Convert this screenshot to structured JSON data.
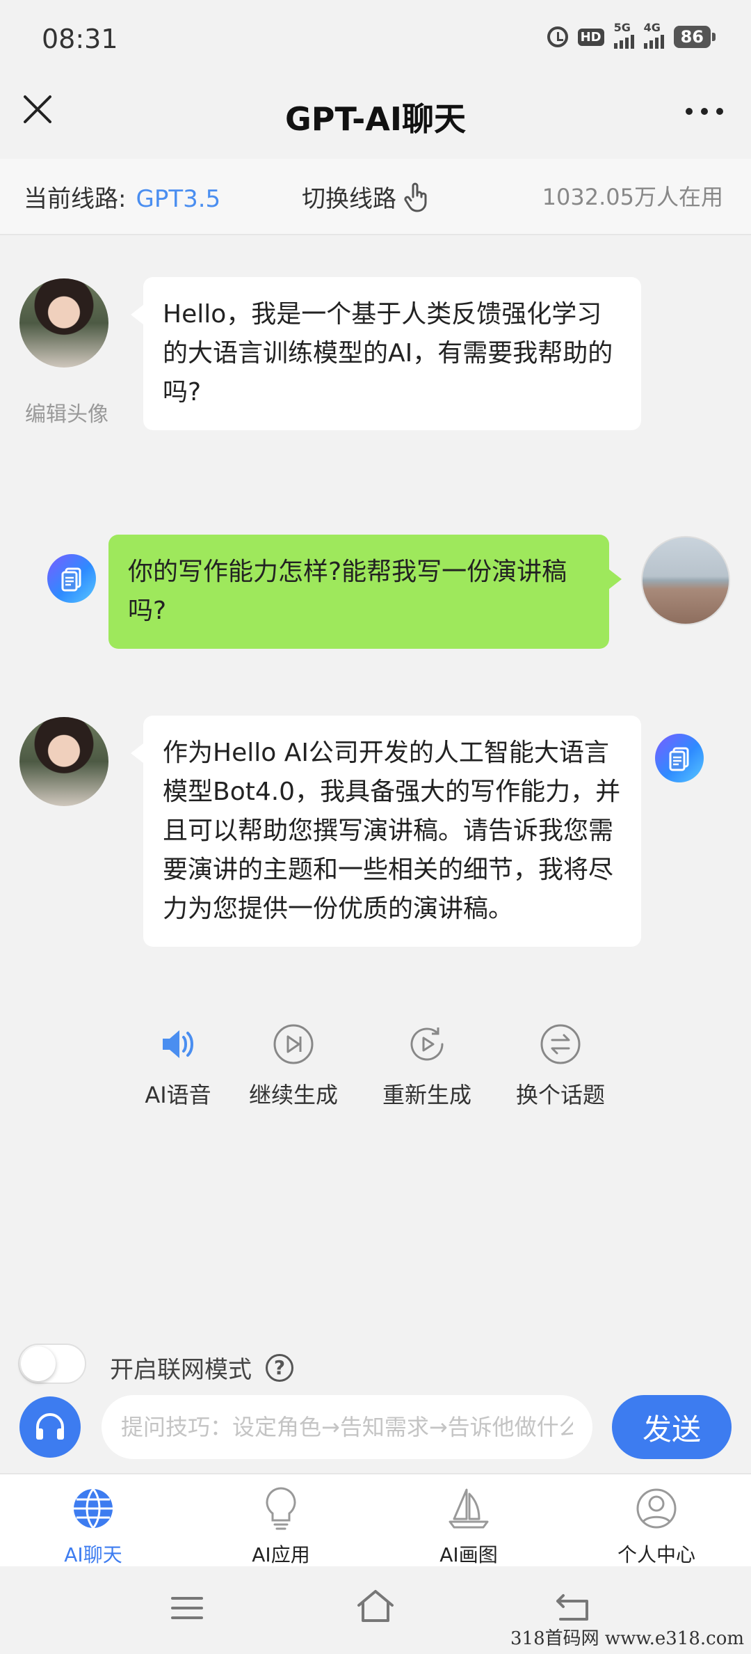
{
  "status_bar": {
    "time": "08:31",
    "hd_label": "HD",
    "net1": "5G",
    "net2": "4G",
    "battery": "86"
  },
  "navbar": {
    "title": "GPT-AI聊天",
    "close_icon": "close-icon",
    "more_icon": "more-icon"
  },
  "line_bar": {
    "current_label": "当前线路:",
    "current_value": "GPT3.5",
    "switch_label": "切换线路",
    "users": "1032.05万人在用"
  },
  "chat": {
    "edit_avatar": "编辑头像",
    "messages": [
      {
        "from": "ai",
        "text": "Hello，我是一个基于人类反馈强化学习的大语言训练模型的AI，有需要我帮助的吗?"
      },
      {
        "from": "user",
        "text": "你的写作能力怎样?能帮我写一份演讲稿吗?"
      },
      {
        "from": "ai",
        "text": "作为Hello AI公司开发的人工智能大语言模型Bot4.0，我具备强大的写作能力，并且可以帮助您撰写演讲稿。请告诉我您需要演讲的主题和一些相关的细节，我将尽力为您提供一份优质的演讲稿。"
      }
    ],
    "actions": [
      {
        "label": "AI语音",
        "icon": "speaker-icon"
      },
      {
        "label": "继续生成",
        "icon": "skip-forward-icon"
      },
      {
        "label": "重新生成",
        "icon": "replay-icon"
      },
      {
        "label": "换个话题",
        "icon": "switch-icon"
      }
    ]
  },
  "composer": {
    "web_mode_label": "开启联网模式",
    "web_mode_on": false,
    "placeholder": "提问技巧：设定角色→告知需求→告诉他做什么",
    "send_label": "发送"
  },
  "tabs": [
    {
      "label": "AI聊天",
      "icon": "globe-icon",
      "active": true
    },
    {
      "label": "AI应用",
      "icon": "lightbulb-icon",
      "active": false
    },
    {
      "label": "AI画图",
      "icon": "sailboat-icon",
      "active": false
    },
    {
      "label": "个人中心",
      "icon": "user-icon",
      "active": false
    }
  ],
  "colors": {
    "accent": "#3d7cf0",
    "user_bubble": "#9ee85c",
    "line_value": "#4a8ef0"
  },
  "watermark": "318首码网  www.e318.com"
}
